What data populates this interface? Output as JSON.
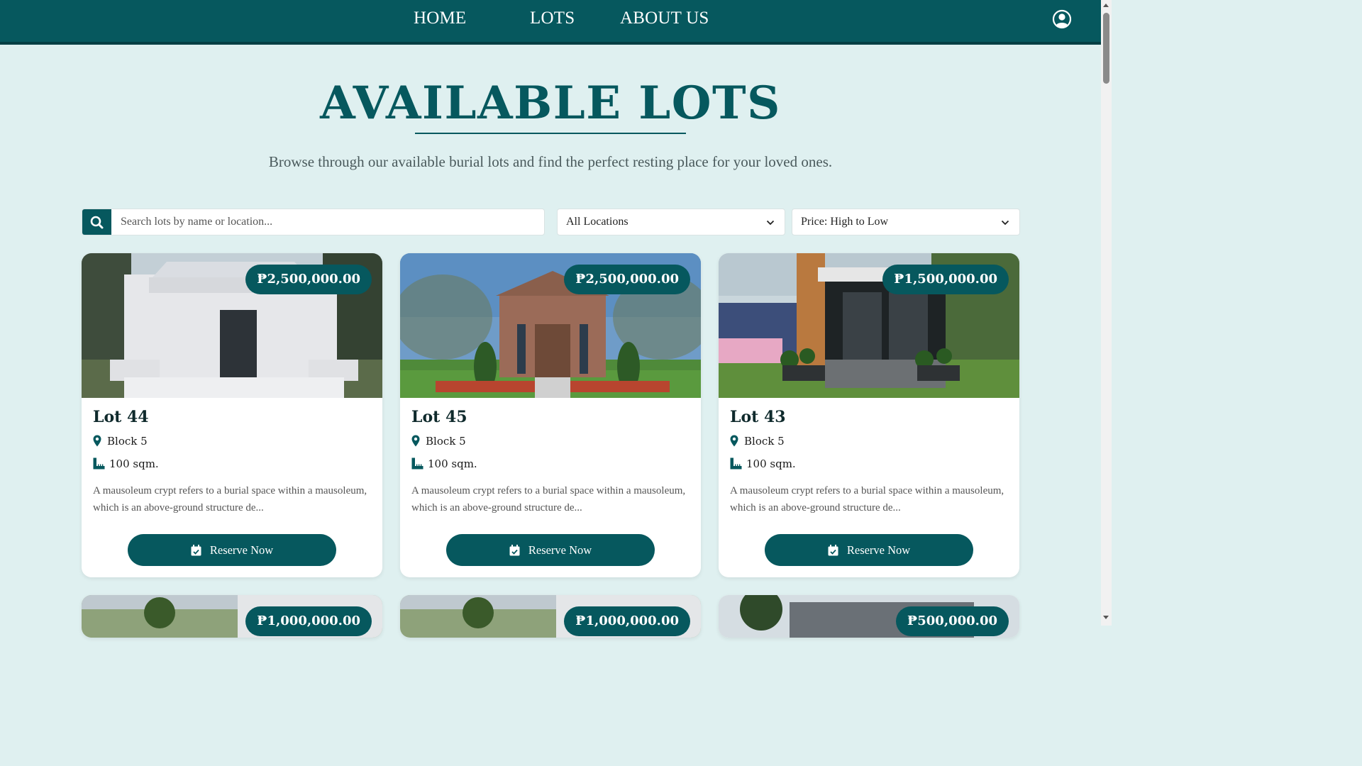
{
  "nav": {
    "home": "HOME",
    "lots": "LOTS",
    "about": "ABOUT US",
    "profile_icon": "user-circle-icon"
  },
  "header": {
    "title": "AVAILABLE LOTS",
    "subtitle": "Browse through our available burial lots and find the perfect resting place for your loved ones."
  },
  "filters": {
    "search_placeholder": "Search lots by name or location...",
    "search_value": "",
    "location_selected": "All Locations",
    "sort_selected": "Price: High to Low"
  },
  "cards": [
    {
      "price": "₱2,500,000.00",
      "name": "Lot 44",
      "block": "Block 5",
      "area": "100 sqm.",
      "description": "A mausoleum crypt refers to a burial space within a mausoleum, which is an above-ground structure de...",
      "button": "Reserve Now"
    },
    {
      "price": "₱2,500,000.00",
      "name": "Lot 45",
      "block": "Block 5",
      "area": "100 sqm.",
      "description": "A mausoleum crypt refers to a burial space within a mausoleum, which is an above-ground structure de...",
      "button": "Reserve Now"
    },
    {
      "price": "₱1,500,000.00",
      "name": "Lot 43",
      "block": "Block 5",
      "area": "100 sqm.",
      "description": "A mausoleum crypt refers to a burial space within a mausoleum, which is an above-ground structure de...",
      "button": "Reserve Now"
    },
    {
      "price": "₱1,000,000.00"
    },
    {
      "price": "₱1,000,000.00"
    },
    {
      "price": "₱500,000.00"
    }
  ],
  "colors": {
    "primary": "#06585e",
    "background": "#dff0f0"
  }
}
